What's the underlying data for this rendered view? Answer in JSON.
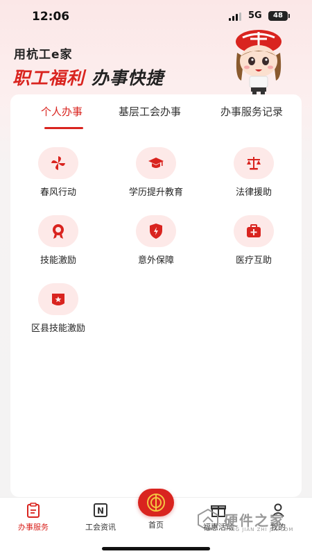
{
  "status_bar": {
    "time": "12:06",
    "network": "5G",
    "battery": "48"
  },
  "header": {
    "app_title": "用杭工e家",
    "slogan_red": "职工福利",
    "slogan_dark": "办事快捷"
  },
  "tabs": [
    {
      "label": "个人办事",
      "active": true
    },
    {
      "label": "基层工会办事",
      "active": false
    },
    {
      "label": "办事服务记录",
      "active": false
    }
  ],
  "services": [
    {
      "label": "春风行动",
      "icon": "pinwheel-icon"
    },
    {
      "label": "学历提升教育",
      "icon": "graduation-cap-icon"
    },
    {
      "label": "法律援助",
      "icon": "scales-icon"
    },
    {
      "label": "技能激励",
      "icon": "medal-icon"
    },
    {
      "label": "意外保障",
      "icon": "shield-icon"
    },
    {
      "label": "医疗互助",
      "icon": "medical-kit-icon"
    },
    {
      "label": "区县技能激励",
      "icon": "badge-icon"
    }
  ],
  "bottom_nav": [
    {
      "label": "办事服务",
      "icon": "clipboard-icon",
      "active": true
    },
    {
      "label": "工会资讯",
      "icon": "news-icon",
      "active": false
    },
    {
      "label": "首页",
      "icon": "union-logo-icon",
      "active": false
    },
    {
      "label": "福惠活动",
      "icon": "gift-icon",
      "active": false
    },
    {
      "label": "我的",
      "icon": "person-icon",
      "active": false
    }
  ],
  "watermark": {
    "text": "硬件之家",
    "sub": "YING JIAN ZHI JIA.COM"
  },
  "colors": {
    "accent": "#d9241f",
    "icon_bg": "#fde9e8"
  }
}
